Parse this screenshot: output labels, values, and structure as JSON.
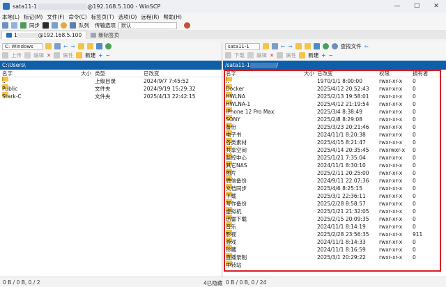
{
  "window": {
    "title_prefix": "sata11-1",
    "title_suffix": "@192.168.5.100 - WinSCP",
    "controls": [
      "—",
      "☐",
      "✕"
    ]
  },
  "menu": [
    "本地(L)",
    "标记(M)",
    "文件(F)",
    "命令(C)",
    "标签页(T)",
    "选项(O)",
    "远程(R)",
    "帮助(H)"
  ],
  "toolbar": {
    "sync": "同步",
    "queue": "队列",
    "transfer_label": "传输选项",
    "transfer_value": "默认"
  },
  "tabs": [
    {
      "label": "1",
      "suffix": "@192.168.5.100"
    },
    {
      "label": "新标签页"
    }
  ],
  "left": {
    "drive": "C: Windows",
    "buttons": {
      "upload": "上传",
      "edit": "编辑",
      "properties": "属性",
      "new": "新建"
    },
    "path": "C:\\Users\\",
    "columns": {
      "name": "名字",
      "size": "大小",
      "type": "类型",
      "changed": "已改变"
    },
    "rows": [
      {
        "name": "..",
        "size": "",
        "type": "上级目录",
        "changed": "2024/9/7  7:45:52"
      },
      {
        "name": "Public",
        "size": "",
        "type": "文件夹",
        "changed": "2024/9/19  15:29:32"
      },
      {
        "name": "Stark-C",
        "size": "",
        "type": "文件夹",
        "changed": "2025/4/13  22:42:15"
      }
    ]
  },
  "right": {
    "drive": "sata11-1",
    "buttons": {
      "download": "下载",
      "edit": "编辑",
      "properties": "属性",
      "new": "新建",
      "find": "查找文件"
    },
    "path_prefix": "/sata11-1",
    "path_suffix": "/",
    "columns": {
      "name": "名字",
      "size": "大小",
      "changed": "已改变",
      "rights": "权限",
      "owner": "拥有者"
    },
    "rows": [
      {
        "name": "..",
        "changed": "1970/1/1  8:00:00",
        "rights": "rwxr-xr-x",
        "owner": "0"
      },
      {
        "name": "Docker",
        "changed": "2025/4/12  20:52:43",
        "rights": "rwxr-xr-x",
        "owner": "0"
      },
      {
        "name": "HWLNA",
        "changed": "2025/2/13  19:58:01",
        "rights": "rwxr-xr-x",
        "owner": "0"
      },
      {
        "name": "HWLNA-1",
        "changed": "2025/4/12  21:19:54",
        "rights": "rwxr-xr-x",
        "owner": "0"
      },
      {
        "name": "iPhone 12 Pro Max",
        "changed": "2025/3/4  8:38:49",
        "rights": "rwxr-xr-x",
        "owner": "0"
      },
      {
        "name": "SONY",
        "changed": "2025/2/8  8:29:08",
        "rights": "rwxr-xr-x",
        "owner": "0"
      },
      {
        "name": "备份",
        "changed": "2025/3/23  20:21:46",
        "rights": "rwxr-xr-x",
        "owner": "0"
      },
      {
        "name": "电子书",
        "changed": "2024/11/1  8:20:38",
        "rights": "rwxr-xr-x",
        "owner": "0"
      },
      {
        "name": "各类素材",
        "changed": "2025/4/15  8:21:47",
        "rights": "rwxr-xr-x",
        "owner": "0"
      },
      {
        "name": "共享空间",
        "changed": "2025/4/14  20:35:45",
        "rights": "rwxrwxr-x",
        "owner": "0"
      },
      {
        "name": "监控中心",
        "changed": "2025/1/21  7:35:04",
        "rights": "rwxr-xr-x",
        "owner": "0"
      },
      {
        "name": "其它NAS",
        "changed": "2024/11/1  8:30:10",
        "rights": "rwxr-xr-x",
        "owner": "0"
      },
      {
        "name": "图片",
        "changed": "2025/2/11  20:25:00",
        "rights": "rwxr-xr-x",
        "owner": "0"
      },
      {
        "name": "微信备份",
        "changed": "2024/9/11  22:07:36",
        "rights": "rwxr-xr-x",
        "owner": "0"
      },
      {
        "name": "文档同步",
        "changed": "2025/4/6  8:25:15",
        "rights": "rwxr-xr-x",
        "owner": "0"
      },
      {
        "name": "下载",
        "changed": "2025/3/1  22:36:11",
        "rights": "rwxr-xr-x",
        "owner": "0"
      },
      {
        "name": "写作备份",
        "changed": "2025/2/28  8:58:57",
        "rights": "rwxr-xr-x",
        "owner": "0"
      },
      {
        "name": "虚拟机",
        "changed": "2025/1/21  21:32:05",
        "rights": "rwxr-xr-x",
        "owner": "0"
      },
      {
        "name": "迅雷下载",
        "changed": "2025/2/15  20:09:35",
        "rights": "rwxr-xr-x",
        "owner": "0"
      },
      {
        "name": "音乐",
        "changed": "2024/11/1  8:14:19",
        "rights": "rwxr-xr-x",
        "owner": "0"
      },
      {
        "name": "影视",
        "changed": "2025/2/28  23:56:35",
        "rights": "rwxr-xr-x",
        "owner": "911"
      },
      {
        "name": "游戏",
        "changed": "2024/11/1  8:14:33",
        "rights": "rwxr-xr-x",
        "owner": "0"
      },
      {
        "name": "珍藏",
        "changed": "2024/11/1  8:16:59",
        "rights": "rwxr-xr-x",
        "owner": "0"
      },
      {
        "name": "直播录制",
        "changed": "2025/3/1  20:29:22",
        "rights": "rwxr-xr-x",
        "owner": "0"
      },
      {
        "name": "中转站",
        "changed": "",
        "rights": "",
        "owner": ""
      }
    ]
  },
  "status": {
    "left": "0 B / 0 B, 0 / 2",
    "hidden": "4已隐藏",
    "right": "0 B / 0 B, 0 / 24"
  }
}
